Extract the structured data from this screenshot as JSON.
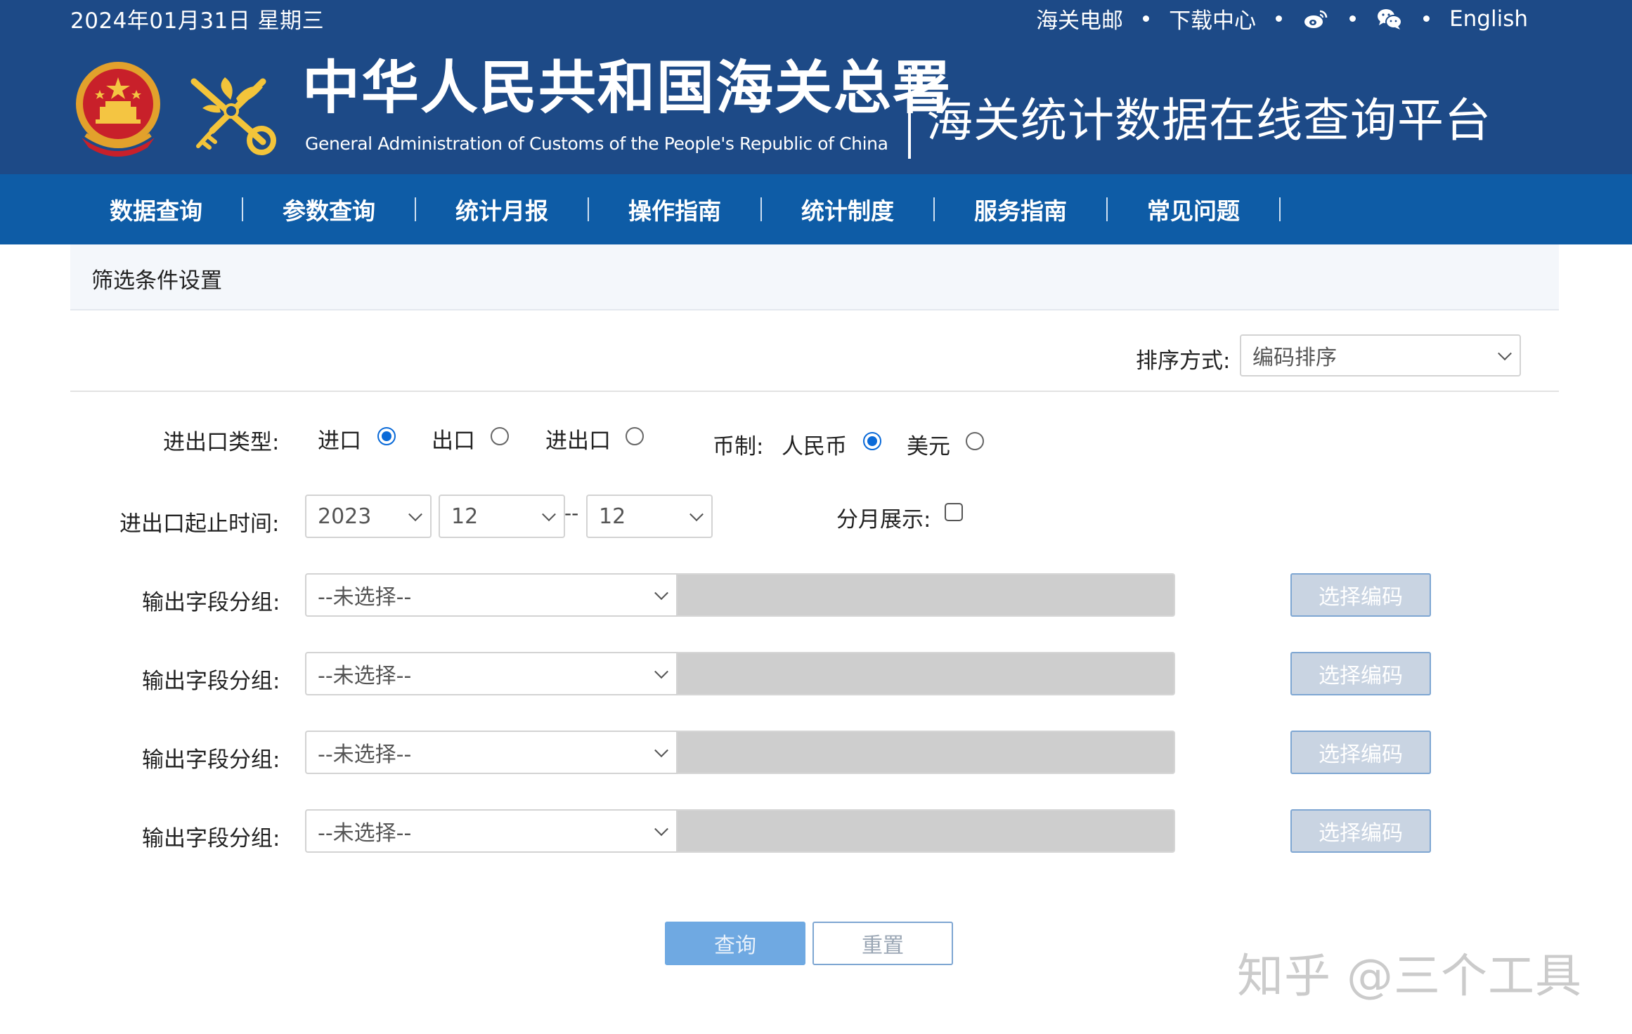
{
  "topbar": {
    "date": "2024年01月31日  星期三",
    "links": [
      "海关电邮",
      "下载中心"
    ],
    "english": "English"
  },
  "icons": {
    "weibo": "weibo-icon",
    "wechat": "wechat-icon"
  },
  "header": {
    "org_cn": "中华人民共和国海关总署",
    "org_en": "General Administration of Customs of the People's Republic of China",
    "platform_title": "海关统计数据在线查询平台"
  },
  "nav": [
    "数据查询",
    "参数查询",
    "统计月报",
    "操作指南",
    "统计制度",
    "服务指南",
    "常见问题"
  ],
  "filter": {
    "panel_title": "筛选条件设置",
    "sort_label": "排序方式:",
    "sort_value": "编码排序",
    "trade_type_label": "进出口类型:",
    "trade_options": [
      "进口",
      "出口",
      "进出口"
    ],
    "trade_selected": "进口",
    "currency_label": "币制:",
    "currency_options": [
      "人民币",
      "美元"
    ],
    "currency_selected": "人民币",
    "period_label": "进出口起止时间:",
    "year": "2023",
    "month_start": "12",
    "month_end": "12",
    "range_dash": "--",
    "monthly_label": "分月展示:",
    "monthly_checked": false,
    "group_label": "输出字段分组:",
    "group_placeholder": "--未选择--",
    "code_button": "选择编码"
  },
  "actions": {
    "query": "查询",
    "reset": "重置"
  },
  "watermark": "知乎 @三个工具",
  "colors": {
    "header_bg": "#1d4a87",
    "nav_bg": "#0e5ca6",
    "accent": "#0a6ad8",
    "query_btn": "#6fa9e2"
  }
}
